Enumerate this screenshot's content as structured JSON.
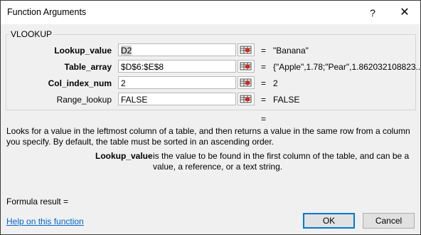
{
  "window": {
    "title": "Function Arguments",
    "help_glyph": "?",
    "close_glyph": "✕"
  },
  "group": {
    "function_name": "VLOOKUP"
  },
  "args": [
    {
      "label": "Lookup_value",
      "bold": true,
      "value": "D2",
      "result": "\"Banana\""
    },
    {
      "label": "Table_array",
      "bold": true,
      "value": "$D$6:$E$8",
      "result": "{\"Apple\",1.78;\"Pear\",1.862032108823..."
    },
    {
      "label": "Col_index_num",
      "bold": true,
      "value": "2",
      "result": "2"
    },
    {
      "label": "Range_lookup",
      "bold": false,
      "value": "FALSE",
      "result": "FALSE"
    }
  ],
  "equals": "=",
  "function_result_equals": "=",
  "description": "Looks for a value in the leftmost column of a table, and then returns a value in the same row from a column you specify. By default, the table must be sorted in an ascending order.",
  "arg_help": {
    "name": "Lookup_value",
    "text": "is the value to be found in the first column of the table, and can be a value, a reference, or a text string."
  },
  "formula_result_label": "Formula result =",
  "help_link": "Help on this function",
  "buttons": {
    "ok": "OK",
    "cancel": "Cancel"
  },
  "icons": {
    "range_picker": "collapse-dialog-icon"
  }
}
